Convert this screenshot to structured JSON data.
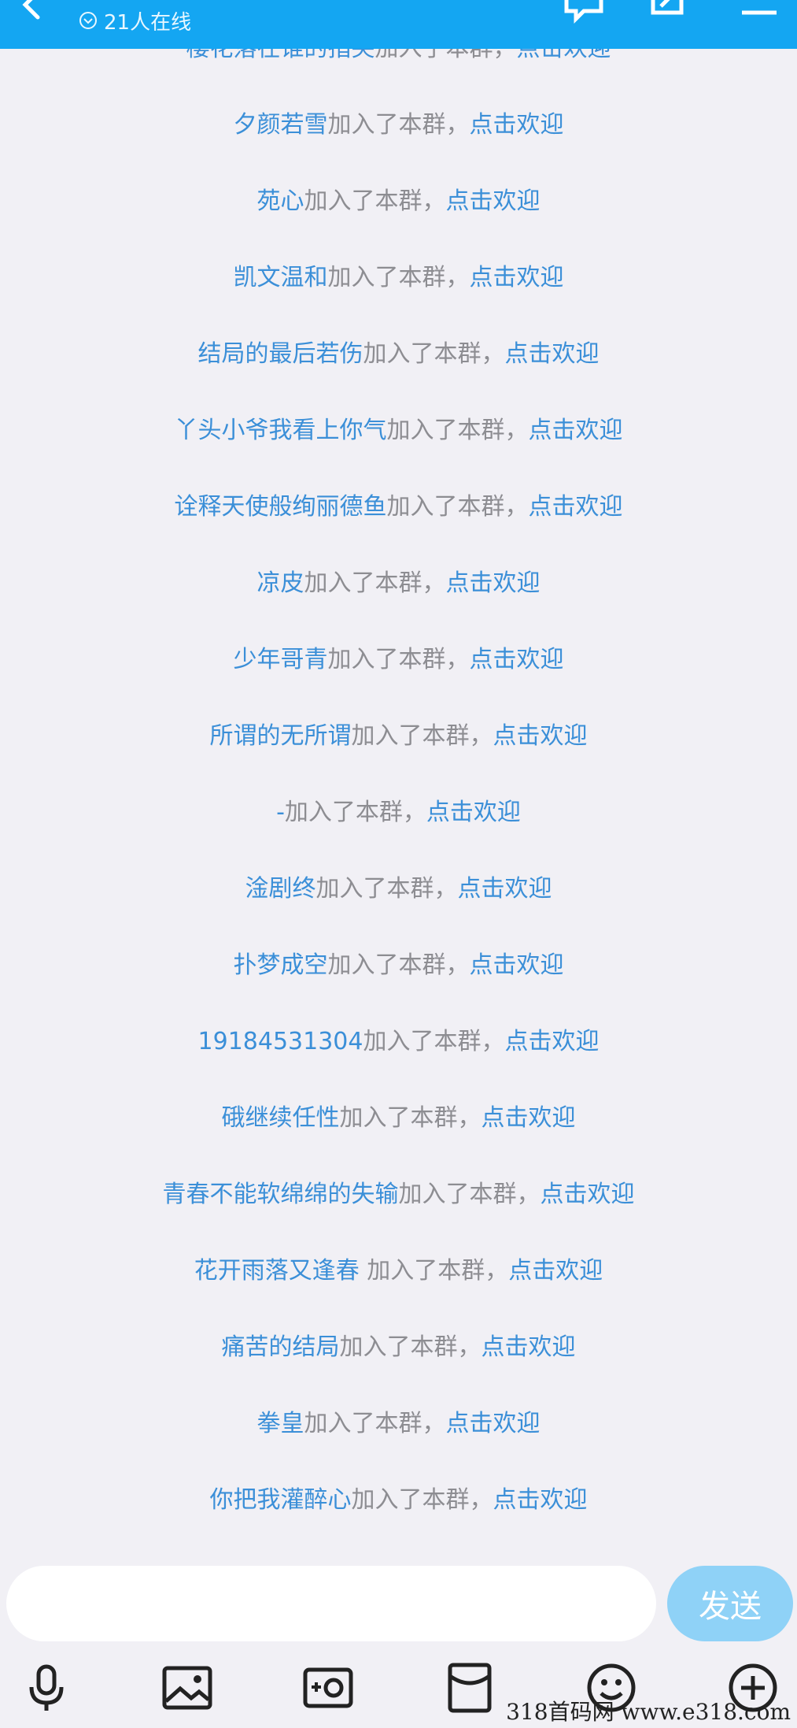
{
  "header": {
    "online_count": "21人在线",
    "accent_color": "#14a6f2"
  },
  "messages": [
    {
      "name": "樱花落在谁的指尖",
      "joined": "加入了本群，",
      "welcome": "点击欢迎"
    },
    {
      "name": "夕颜若雪",
      "joined": "加入了本群，",
      "welcome": "点击欢迎"
    },
    {
      "name": "苑心",
      "joined": "加入了本群，",
      "welcome": "点击欢迎"
    },
    {
      "name": "凯文温和",
      "joined": "加入了本群，",
      "welcome": "点击欢迎"
    },
    {
      "name": "结局的最后若伤",
      "joined": "加入了本群，",
      "welcome": "点击欢迎"
    },
    {
      "name": "丫头小爷我看上你气",
      "joined": "加入了本群，",
      "welcome": "点击欢迎"
    },
    {
      "name": "诠释天使般绚丽德鱼",
      "joined": "加入了本群，",
      "welcome": "点击欢迎"
    },
    {
      "name": "凉皮",
      "joined": "加入了本群，",
      "welcome": "点击欢迎"
    },
    {
      "name": "少年哥青",
      "joined": "加入了本群，",
      "welcome": "点击欢迎"
    },
    {
      "name": "所谓的无所谓",
      "joined": "加入了本群，",
      "welcome": "点击欢迎"
    },
    {
      "name": "-",
      "joined": "加入了本群，",
      "welcome": "点击欢迎"
    },
    {
      "name": "淦剧终",
      "joined": "加入了本群，",
      "welcome": "点击欢迎"
    },
    {
      "name": "扑梦成空",
      "joined": "加入了本群，",
      "welcome": "点击欢迎"
    },
    {
      "name": "19184531304",
      "joined": "加入了本群，",
      "welcome": "点击欢迎"
    },
    {
      "name": "硪继续任性",
      "joined": "加入了本群，",
      "welcome": "点击欢迎"
    },
    {
      "name": "青春不能软绵绵的失输",
      "joined": "加入了本群，",
      "welcome": "点击欢迎"
    },
    {
      "name": "花开雨落又逢春 ",
      "joined": "加入了本群，",
      "welcome": "点击欢迎"
    },
    {
      "name": "痛苦的结局",
      "joined": "加入了本群，",
      "welcome": "点击欢迎"
    },
    {
      "name": "拳皇",
      "joined": "加入了本群，",
      "welcome": "点击欢迎"
    },
    {
      "name": "你把我灌醉心",
      "joined": "加入了本群，",
      "welcome": "点击欢迎"
    }
  ],
  "input": {
    "value": "",
    "send_label": "发送"
  },
  "toolbar": {
    "icons": [
      "microphone-icon",
      "image-icon",
      "camera-icon",
      "red-packet-icon",
      "emoji-icon",
      "plus-icon"
    ]
  },
  "watermark": "318首码网  www.e318.com"
}
